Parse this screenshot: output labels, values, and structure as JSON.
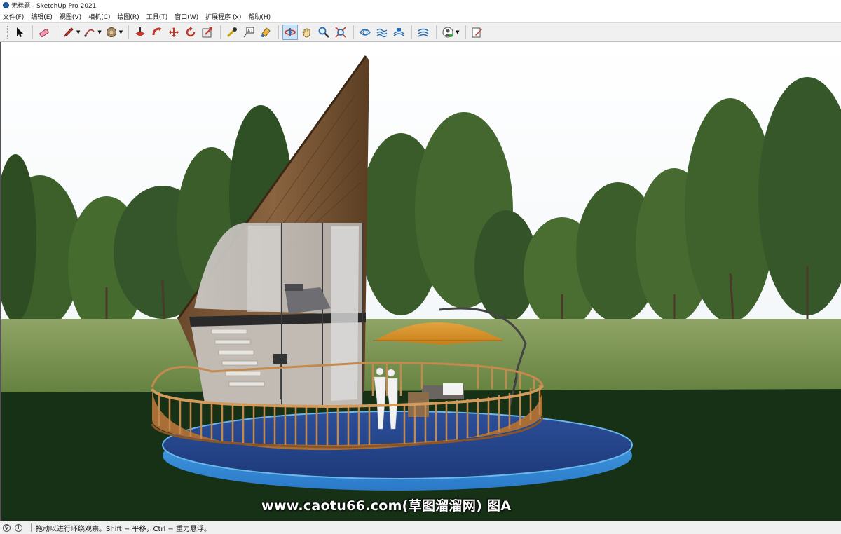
{
  "window": {
    "title": "无标题 - SketchUp Pro 2021"
  },
  "menu": [
    {
      "id": "file",
      "label": "文件(F)"
    },
    {
      "id": "edit",
      "label": "编辑(E)"
    },
    {
      "id": "view",
      "label": "视图(V)"
    },
    {
      "id": "camera",
      "label": "相机(C)"
    },
    {
      "id": "draw",
      "label": "绘图(R)"
    },
    {
      "id": "tools",
      "label": "工具(T)"
    },
    {
      "id": "window",
      "label": "窗口(W)"
    },
    {
      "id": "extensions",
      "label": "扩展程序 (x)"
    },
    {
      "id": "help",
      "label": "帮助(H)"
    }
  ],
  "toolbar": {
    "tools": [
      {
        "icon": "select-arrow-icon"
      },
      {
        "icon": "eraser-icon"
      },
      {
        "icon": "pencil-line-icon"
      },
      {
        "icon": "arc-icon"
      },
      {
        "icon": "paint-bucket-icon"
      },
      {
        "icon": "push-pull-icon"
      },
      {
        "icon": "follow-me-icon"
      },
      {
        "icon": "move-icon"
      },
      {
        "icon": "rotate-icon"
      },
      {
        "icon": "scale-icon"
      },
      {
        "icon": "tape-measure-icon"
      },
      {
        "icon": "text-label-icon"
      },
      {
        "icon": "paint-icon"
      },
      {
        "icon": "orbit-icon",
        "active": true
      },
      {
        "icon": "pan-hand-icon"
      },
      {
        "icon": "zoom-icon"
      },
      {
        "icon": "zoom-extents-icon"
      },
      {
        "icon": "sandbox-icon"
      },
      {
        "icon": "smoove-icon"
      },
      {
        "icon": "stamp-icon"
      },
      {
        "icon": "drape-icon"
      },
      {
        "icon": "user-account-icon"
      },
      {
        "icon": "edit-notes-icon"
      }
    ],
    "accent": "#2a6fb5"
  },
  "watermark": {
    "text": "www.caotu66.com(草图溜溜网) 图A"
  },
  "statusbar": {
    "hint": "拖动以进行环绕观察。Shift = 平移，Ctrl = 重力悬浮。"
  }
}
